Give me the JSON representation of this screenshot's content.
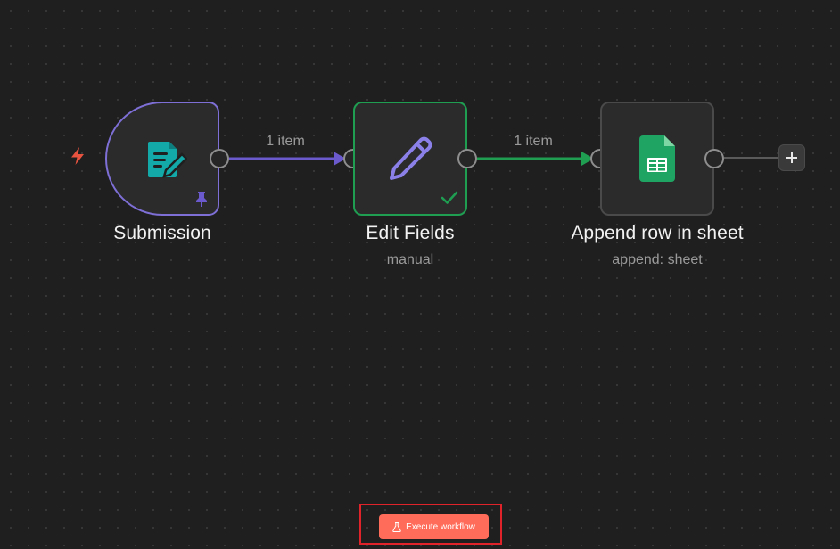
{
  "canvas": {
    "background": "#1f1f1f",
    "accent_trigger": "#7d6fd6",
    "accent_success": "#1f9e52",
    "accent_trigger_icon": "#e8533f"
  },
  "nodes": [
    {
      "id": "submission",
      "title": "Submission",
      "subtitle": "",
      "icon": "form-edit-icon",
      "icon_color": "#13a9a9",
      "badge": "pin-icon",
      "border_color": "#7d6fd6"
    },
    {
      "id": "edit-fields",
      "title": "Edit Fields",
      "subtitle": "manual",
      "icon": "pencil-icon",
      "icon_color": "#8a80e8",
      "badge": "check-icon",
      "border_color": "#1f9e52"
    },
    {
      "id": "append-row",
      "title": "Append row in sheet",
      "subtitle": "append: sheet",
      "icon": "google-sheets-icon",
      "icon_color": "#1fa463",
      "badge": "",
      "border_color": "#4a4a4a"
    }
  ],
  "edges": [
    {
      "label": "1 item",
      "color": "#6a5acd"
    },
    {
      "label": "1 item",
      "color": "#1f9e52"
    }
  ],
  "toolbar": {
    "execute_label": "Execute workflow",
    "execute_icon": "flask-icon",
    "execute_color": "#ff6d5a"
  }
}
